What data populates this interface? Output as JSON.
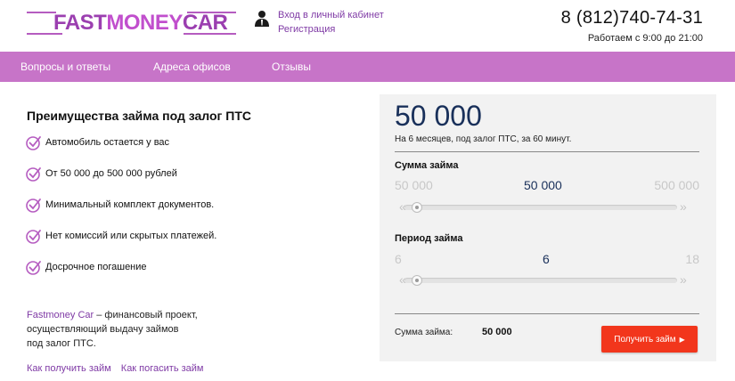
{
  "header": {
    "logo": {
      "part1": "FAST",
      "part2": "MONEY",
      "part3": "CAR"
    },
    "login_link": "Вход в личный кабинет",
    "register_link": "Регистрация",
    "phone": "8 (812)740-74-31",
    "hours": "Работаем с 9:00 до 21:00"
  },
  "nav": {
    "items": [
      {
        "label": "Вопросы и ответы"
      },
      {
        "label": "Адреса офисов"
      },
      {
        "label": "Отзывы"
      }
    ]
  },
  "advantages": {
    "title": "Преимущества займа под залог ПТС",
    "items": [
      {
        "label": "Автомобиль остается у вас"
      },
      {
        "label": "От 50 000 до 500 000 рублей"
      },
      {
        "label": "Минимальный комплект документов."
      },
      {
        "label": "Нет комиссий или скрытых платежей."
      },
      {
        "label": "Досрочное погашение"
      }
    ]
  },
  "about": {
    "brand": "Fastmoney Car",
    "line1_rest": " – финансовый проект,",
    "line2": "осуществляющий выдачу займов",
    "line3": "под залог ПТС."
  },
  "footer_links": {
    "how_to_get": "Как получить займ",
    "how_to_repay": "Как погасить займ"
  },
  "calculator": {
    "amount_display": "50 000",
    "amount_subtitle": "На 6 месяцев, под залог ПТС, за 60 минут.",
    "amount_slider": {
      "title": "Сумма займа",
      "min": "50 000",
      "value": "50 000",
      "max": "500 000",
      "position_fraction": 0.0
    },
    "period_slider": {
      "title": "Период займа",
      "min": "6",
      "value": "6",
      "max": "18",
      "position_fraction": 0.0
    },
    "summary_label": "Сумма займа:",
    "summary_value": "50 000",
    "submit_label": "Получить займ",
    "submit_icon": "play-icon"
  },
  "colors": {
    "brand_purple": "#c774c8",
    "link_purple": "#7f3aa5",
    "button_red": "#f2361c",
    "amount_navy": "#19305a"
  }
}
